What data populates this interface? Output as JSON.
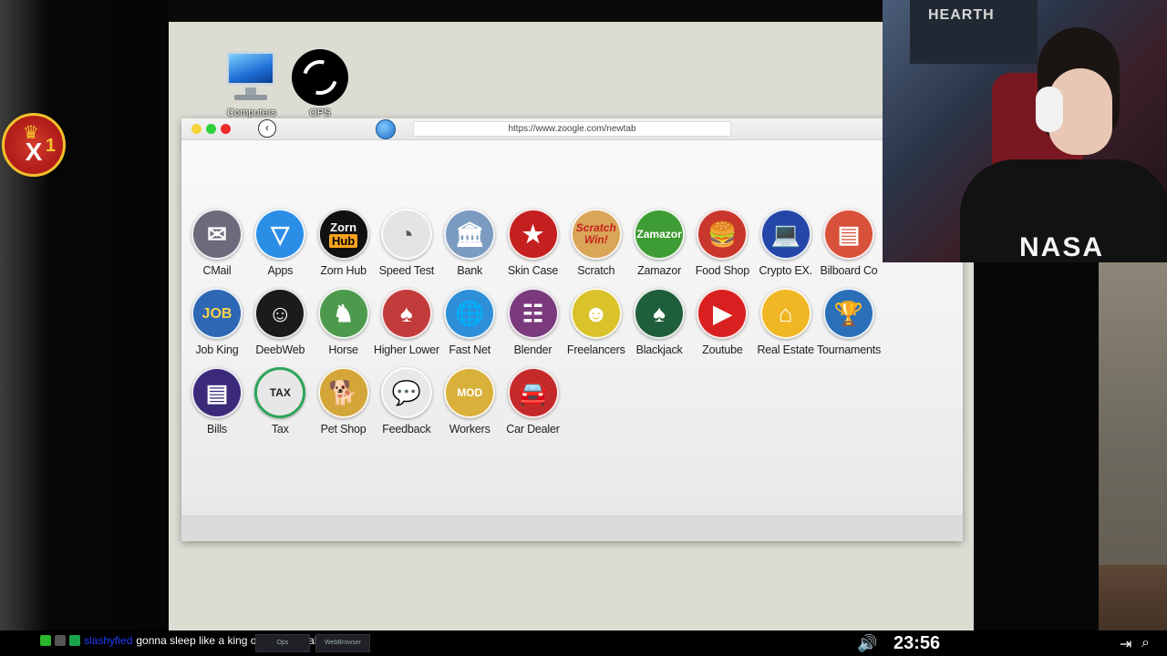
{
  "browser": {
    "url": "https://www.zoogle.com/newtab",
    "back_symbol": "‹"
  },
  "desktop_icons": [
    {
      "label": "Computers",
      "icon": "computer-icon"
    },
    {
      "label": "OPS",
      "icon": "ops-icon"
    }
  ],
  "apps": [
    {
      "label": "CMail",
      "icon": "mail-icon",
      "color": "#6b6b7b",
      "glyph": "✉"
    },
    {
      "label": "Apps",
      "icon": "apps-icon",
      "color": "#2a8ee6",
      "glyph": "▽"
    },
    {
      "label": "Zorn Hub",
      "icon": "zorn-hub-icon",
      "color": "#111111"
    },
    {
      "label": "Speed Test",
      "icon": "speedometer-icon",
      "color": "#e4e4e4",
      "glyph": "◔"
    },
    {
      "label": "Bank",
      "icon": "bank-icon",
      "color": "#7b9bc0",
      "glyph": "🏛"
    },
    {
      "label": "Skin Case",
      "icon": "knife-icon",
      "color": "#c3201f",
      "glyph": "★"
    },
    {
      "label": "Scratch",
      "icon": "scratch-icon",
      "color": "#d9a557",
      "logo": "Scratch Win!"
    },
    {
      "label": "Zamazor",
      "icon": "zamazor-icon",
      "color": "#3e9c34",
      "logo": "Zamazor"
    },
    {
      "label": "Food Shop",
      "icon": "burger-icon",
      "color": "#c9372c",
      "glyph": "🍔"
    },
    {
      "label": "Crypto EX.",
      "icon": "crypto-icon",
      "color": "#2346a8",
      "glyph": "💻"
    },
    {
      "label": "Bilboard Co",
      "icon": "billboard-icon",
      "color": "#d8513a",
      "glyph": "▤"
    },
    {
      "label": "Job King",
      "icon": "job-icon",
      "color": "#2e67b3",
      "logo": "JOB"
    },
    {
      "label": "DeebWeb",
      "icon": "mask-icon",
      "color": "#1b1b1b",
      "glyph": "☺"
    },
    {
      "label": "Horse",
      "icon": "horse-icon",
      "color": "#4d9a4d",
      "glyph": "♞"
    },
    {
      "label": "Higher Lower",
      "icon": "cards-icon",
      "color": "#c23b3b",
      "glyph": "♠"
    },
    {
      "label": "Fast Net",
      "icon": "globe-icon",
      "color": "#2e8fd8",
      "glyph": "🌐"
    },
    {
      "label": "Blender",
      "icon": "mixer-icon",
      "color": "#7a3a7c",
      "glyph": "☷"
    },
    {
      "label": "Freelancers",
      "icon": "freelancer-icon",
      "color": "#d9c22a",
      "glyph": "☻"
    },
    {
      "label": "Blackjack",
      "icon": "blackjack-icon",
      "color": "#1f5e3a",
      "glyph": "♠"
    },
    {
      "label": "Zoutube",
      "icon": "video-icon",
      "color": "#d92020",
      "glyph": "▶"
    },
    {
      "label": "Real Estate",
      "icon": "house-icon",
      "color": "#f0b623",
      "glyph": "⌂"
    },
    {
      "label": "Tournaments",
      "icon": "trophy-icon",
      "color": "#2a6fb8",
      "glyph": "🏆"
    },
    {
      "label": "Bills",
      "icon": "bill-icon",
      "color": "#3b2a7a",
      "glyph": "▤"
    },
    {
      "label": "Tax",
      "icon": "tax-icon",
      "color": "#2da55a",
      "logo": "TAX"
    },
    {
      "label": "Pet Shop",
      "icon": "dog-icon",
      "color": "#d4a63a",
      "glyph": "🐕"
    },
    {
      "label": "Feedback",
      "icon": "feedback-icon",
      "color": "#e8e8e8",
      "glyph": "💬"
    },
    {
      "label": "Workers",
      "icon": "worker-icon",
      "color": "#d9b13a",
      "logo": "MOD"
    },
    {
      "label": "Car Dealer",
      "icon": "car-icon",
      "color": "#c42a2a",
      "glyph": "🚘"
    }
  ],
  "overlay": {
    "badge_x": "X",
    "badge_count": "1",
    "crown": "♛"
  },
  "webcam": {
    "poster_text": "HEARTH",
    "shirt_text": "NASA"
  },
  "taskbar": {
    "chat_user": "slashyfied",
    "chat_message": "gonna sleep like a king on that bed also",
    "task_buttons": [
      "Ops",
      "WebBrowser"
    ],
    "volume_icon": "speaker-icon",
    "clock": "23:56"
  }
}
